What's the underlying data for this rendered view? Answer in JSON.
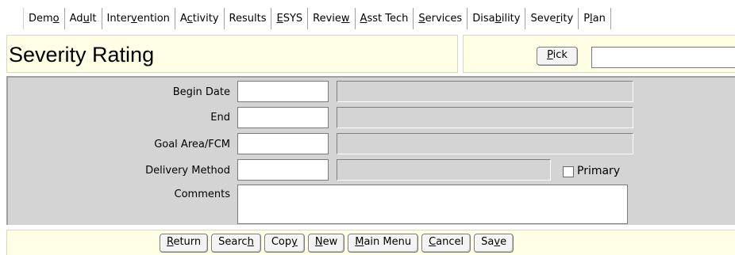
{
  "tabs": [
    {
      "pre": "Dem",
      "u": "o",
      "post": ""
    },
    {
      "pre": "Ad",
      "u": "u",
      "post": "lt"
    },
    {
      "pre": "Inter",
      "u": "v",
      "post": "ention"
    },
    {
      "pre": "A",
      "u": "c",
      "post": "tivity"
    },
    {
      "pre": "Results",
      "u": "",
      "post": ""
    },
    {
      "pre": "",
      "u": "E",
      "post": "SYS"
    },
    {
      "pre": "Revie",
      "u": "w",
      "post": ""
    },
    {
      "pre": "",
      "u": "A",
      "post": "sst Tech"
    },
    {
      "pre": "",
      "u": "S",
      "post": "ervices"
    },
    {
      "pre": "Disa",
      "u": "b",
      "post": "ility"
    },
    {
      "pre": "Seve",
      "u": "r",
      "post": "ity"
    },
    {
      "pre": "P",
      "u": "l",
      "post": "an"
    }
  ],
  "header": {
    "title": "Severity Rating",
    "pick": {
      "pre": "",
      "u": "P",
      "post": "ick"
    },
    "pick_value": ""
  },
  "form": {
    "begin_date_label": "Begin Date",
    "end_label": "End",
    "goal_area_label": "Goal Area/FCM",
    "delivery_method_label": "Delivery Method",
    "comments_label": "Comments",
    "primary_label": "Primary",
    "primary_checked": false,
    "begin_date_value": "",
    "end_value": "",
    "goal_area_value": "",
    "delivery_method_value": "",
    "comments_value": ""
  },
  "buttons": [
    {
      "pre": "",
      "u": "R",
      "post": "eturn"
    },
    {
      "pre": "Searc",
      "u": "h",
      "post": ""
    },
    {
      "pre": "Cop",
      "u": "y",
      "post": ""
    },
    {
      "pre": "",
      "u": "N",
      "post": "ew"
    },
    {
      "pre": "",
      "u": "M",
      "post": "ain Menu"
    },
    {
      "pre": "",
      "u": "C",
      "post": "ancel"
    },
    {
      "pre": "Sa",
      "u": "v",
      "post": "e"
    }
  ],
  "colors": {
    "header_bg": "#ffffe6",
    "form_bg": "#d4d4d4"
  }
}
